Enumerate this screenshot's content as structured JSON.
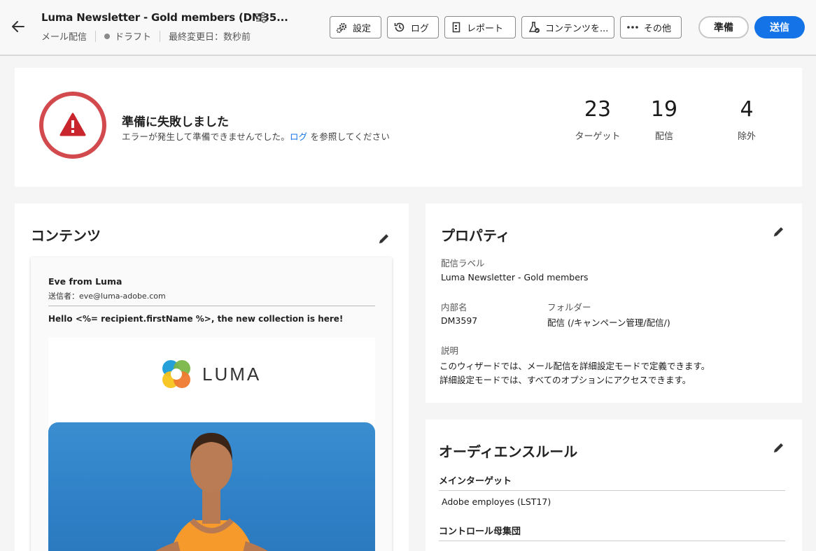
{
  "header": {
    "title": "Luma Newsletter - Gold members (DM35...",
    "channel": "メール配信",
    "state": "ドラフト",
    "modified": "最終変更日：数秒前",
    "toolbar": {
      "settings": "設定",
      "logs": "ログ",
      "report": "レポート",
      "content_test": "コンテンツを...",
      "more": "その他"
    },
    "prepare": "準備",
    "send": "送信"
  },
  "status": {
    "title": "準備に失敗しました",
    "message_prefix": "エラーが発生して準備できませんでした。",
    "message_link": "ログ",
    "message_suffix": "を参照してください",
    "stats": [
      {
        "value": "23",
        "label": "ターゲット"
      },
      {
        "value": "19",
        "label": "配信"
      },
      {
        "value": "4",
        "label": "除外"
      }
    ]
  },
  "content": {
    "title": "コンテンツ",
    "from_name": "Eve from Luma",
    "from_address": "送信者：eve@luma-adobe.com",
    "subject": "Hello <%= recipient.firstName %>, the new collection is here!",
    "logo_text": "LUMA"
  },
  "properties": {
    "title": "プロパティ",
    "delivery_label_caption": "配信ラベル",
    "delivery_label": "Luma Newsletter - Gold members",
    "internal_name_caption": "内部名",
    "internal_name": "DM3597",
    "folder_caption": "フォルダー",
    "folder": "配信 (/キャンペーン管理/配信/)",
    "description_caption": "説明",
    "description_line1": "このウィザードでは、メール配信を詳細設定モードで定義できます。",
    "description_line2": "詳細設定モードでは、すべてのオプションにアクセスできます。"
  },
  "audience": {
    "title": "オーディエンスルール",
    "main_target_caption": "メインターゲット",
    "main_target": "Adobe employes (LST17)",
    "control_group_caption": "コントロール母集団"
  },
  "colors": {
    "primary": "#1473e6",
    "error": "#c9252c",
    "error_ring": "#d24a4d"
  }
}
